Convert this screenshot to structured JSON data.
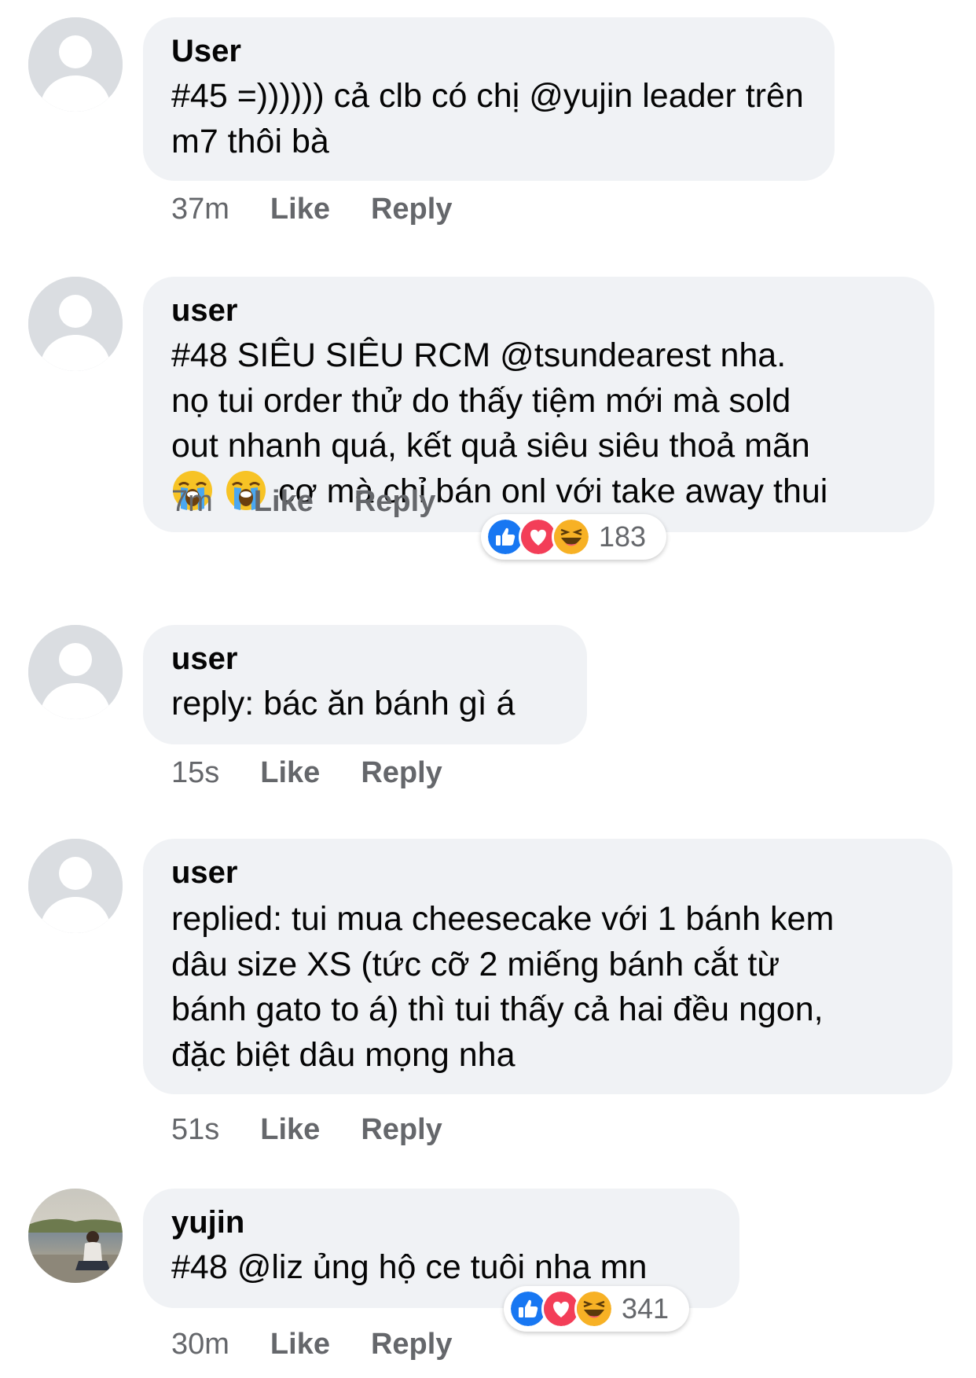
{
  "comments": [
    {
      "author": "User",
      "lines": [
        "#45 =)))))) cả clb có chị @yujin leader trên",
        "m7 thôi bà"
      ],
      "time": "37m",
      "like_label": "Like",
      "reply_label": "Reply"
    },
    {
      "author": "user",
      "lines": [
        "#48 SIÊU SIÊU RCM @tsundearest nha.",
        "nọ tui order thử do thấy tiệm mới mà sold",
        "out nhanh quá, kết quả siêu siêu thoả mãn"
      ],
      "last_line": "cơ mà chỉ bán onl với take away thui",
      "emojis": [
        "loudly-crying-face-icon",
        "loudly-crying-face-icon"
      ],
      "time": "7m",
      "like_label": "Like",
      "reply_label": "Reply",
      "reactions": {
        "icons": [
          "like-reaction-icon",
          "love-reaction-icon",
          "haha-reaction-icon"
        ],
        "count": "183"
      }
    },
    {
      "author": "user",
      "lines": [
        "reply: bác ăn bánh gì á"
      ],
      "time": "15s",
      "like_label": "Like",
      "reply_label": "Reply"
    },
    {
      "author": "user",
      "lines": [
        "replied: tui mua cheesecake với 1 bánh kem",
        "dâu size XS (tức cỡ 2 miếng bánh cắt từ",
        "bánh gato to á) thì tui thấy cả hai đều ngon,",
        "đặc biệt dâu mọng nha"
      ],
      "time": "51s",
      "like_label": "Like",
      "reply_label": "Reply"
    },
    {
      "author": "yujin",
      "lines": [
        "#48 @liz ủng hộ ce tuôi nha mn"
      ],
      "time": "30m",
      "like_label": "Like",
      "reply_label": "Reply",
      "reactions": {
        "icons": [
          "like-reaction-icon",
          "love-reaction-icon",
          "haha-reaction-icon"
        ],
        "count": "341"
      }
    }
  ],
  "colors": {
    "bubble": "#f0f2f5",
    "meta_text": "#65676b",
    "like_blue": "#1877f2",
    "love_red": "#f33e58",
    "haha_yellow": "#f7b125"
  }
}
